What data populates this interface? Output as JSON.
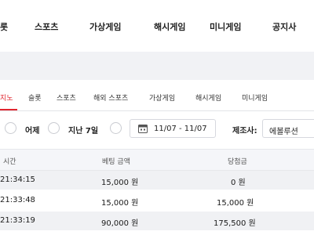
{
  "top_nav": [
    "롯",
    "스포츠",
    "가상게임",
    "해시게임",
    "미니게임",
    "공지사"
  ],
  "tabs": {
    "active": "지노",
    "items": [
      "슬롯",
      "스포츠",
      "해외 스포츠",
      "가상게임",
      "해시게임",
      "미니게임"
    ]
  },
  "filters": {
    "yesterday": "어제",
    "last7": "지난 7일",
    "date_range": "11/07 - 11/07",
    "provider_label": "제조사:",
    "provider_value": "에볼루션"
  },
  "table": {
    "headers": [
      "시간",
      "베팅 금액",
      "당첨금"
    ],
    "rows": [
      [
        "21:34:15",
        "15,000 원",
        "0 원"
      ],
      [
        "21:33:48",
        "15,000 원",
        "15,000 원"
      ],
      [
        "21:33:19",
        "90,000 원",
        "175,500 원"
      ]
    ]
  },
  "colors": {
    "active_tab": "#e0262f",
    "band": "#f1f2f5",
    "row_shade": "#f0f1f4"
  }
}
